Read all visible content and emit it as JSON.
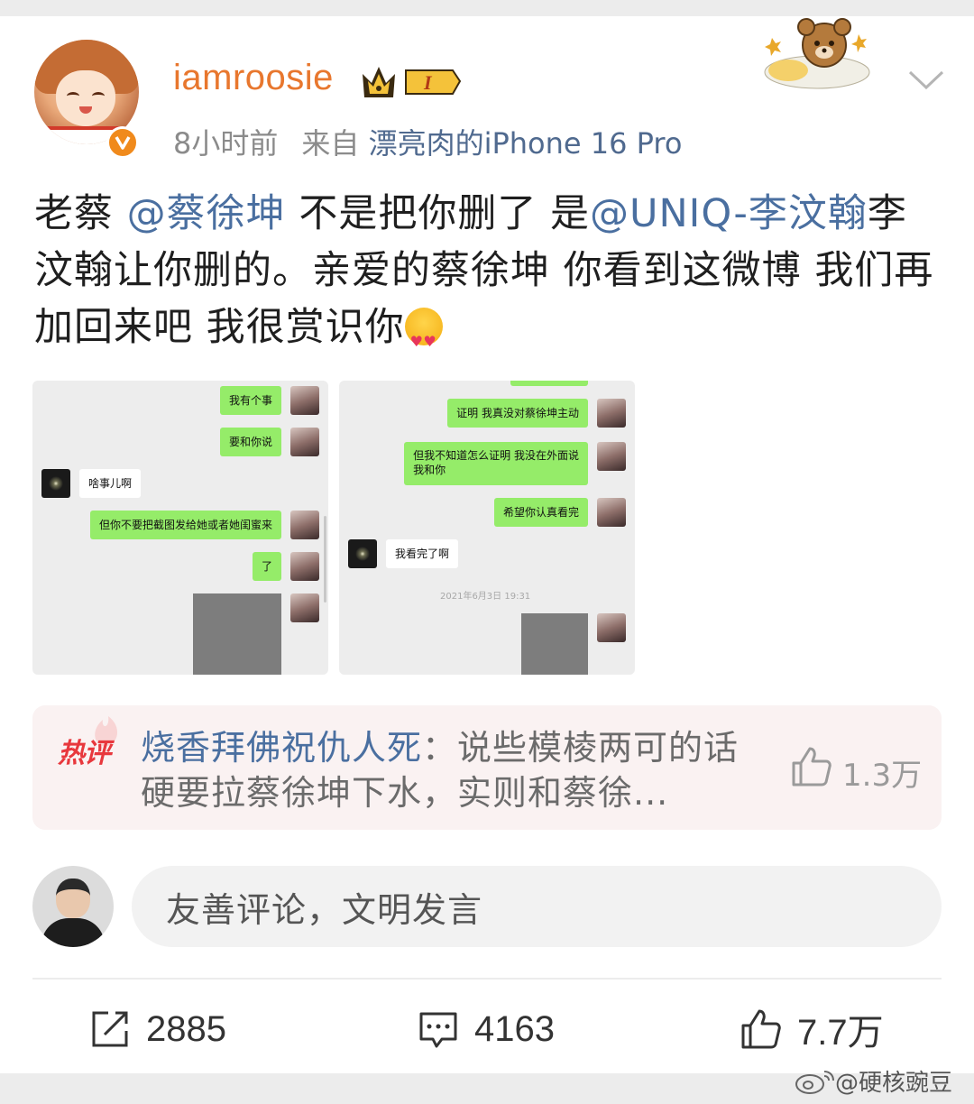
{
  "post": {
    "username": "iamroosie",
    "level_badge": "I",
    "time": "8小时前",
    "source_prefix": "来自",
    "source_device": "漂亮肉的iPhone 16 Pro",
    "text_part1": "老蔡 ",
    "mention1": "@蔡徐坤",
    "text_part2": " 不是把你删了 是",
    "mention2": "@UNIQ-李汶翰",
    "text_part3": "李汶翰让你删的。亲爱的蔡徐坤 你看到这微博 我们再加回来吧 我很赏识你",
    "emoji_icon": "heart-eyes-emoji"
  },
  "chat1": {
    "messages": [
      {
        "side": "me",
        "text": "我有个事"
      },
      {
        "side": "me",
        "text": "要和你说"
      },
      {
        "side": "them",
        "text": "啥事儿啊"
      },
      {
        "side": "me",
        "text": "但你不要把截图发给她或者她闺蜜来"
      },
      {
        "side": "me",
        "text": "了"
      }
    ]
  },
  "chat2": {
    "messages": [
      {
        "side": "me",
        "text": "证明 我真没对蔡徐坤主动"
      },
      {
        "side": "me",
        "text": "但我不知道怎么证明 我没在外面说"
      },
      {
        "side": "me",
        "text": "我和你"
      },
      {
        "side": "me",
        "text": "希望你认真看完"
      },
      {
        "side": "them",
        "text": "我看完了啊"
      }
    ],
    "timestamp": "2021年6月3日 19:31"
  },
  "hot_comment": {
    "tag": "热评",
    "author": "烧香拜佛祝仇人死",
    "separator": "：",
    "text": "说些模棱两可的话硬要拉蔡徐坤下水，实则和蔡徐...",
    "likes": "1.3万"
  },
  "composer": {
    "placeholder": "友善评论，文明发言"
  },
  "actions": {
    "reposts": "2885",
    "comments": "4163",
    "likes": "7.7万"
  },
  "watermark": {
    "text": "@硬核豌豆"
  },
  "colors": {
    "username": "#e8772e",
    "link": "#4a6fa0",
    "hot_tag": "#e8383d",
    "chat_bubble_me": "#95ec69"
  }
}
